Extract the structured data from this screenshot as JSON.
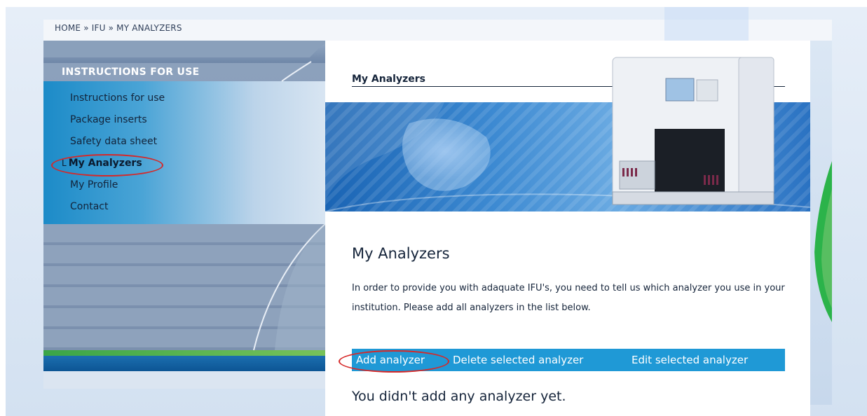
{
  "breadcrumb": "HOME » IFU » MY ANALYZERS",
  "sidebar": {
    "title": "INSTRUCTIONS FOR USE",
    "items": [
      {
        "label": "Instructions for use"
      },
      {
        "label": "Package inserts"
      },
      {
        "label": "Safety data sheet"
      },
      {
        "label": "My Analyzers",
        "prefix": "L",
        "active": true
      },
      {
        "label": "My Profile"
      },
      {
        "label": "Contact"
      }
    ]
  },
  "banner": {
    "title": "My Analyzers"
  },
  "content": {
    "title": "My Analyzers",
    "description": "In order to provide you with adaquate IFU's, you need to tell us which analyzer you use in your institution. Please add all analyzers in the list below.",
    "actions": {
      "add": "Add analyzer",
      "delete": "Delete selected analyzer",
      "edit": "Edit selected analyzer"
    },
    "empty_message": "You didn't add any analyzer yet."
  },
  "colors": {
    "action_bar": "#1f99d6",
    "highlight_oval": "#d62828",
    "text_dark": "#15243a"
  }
}
